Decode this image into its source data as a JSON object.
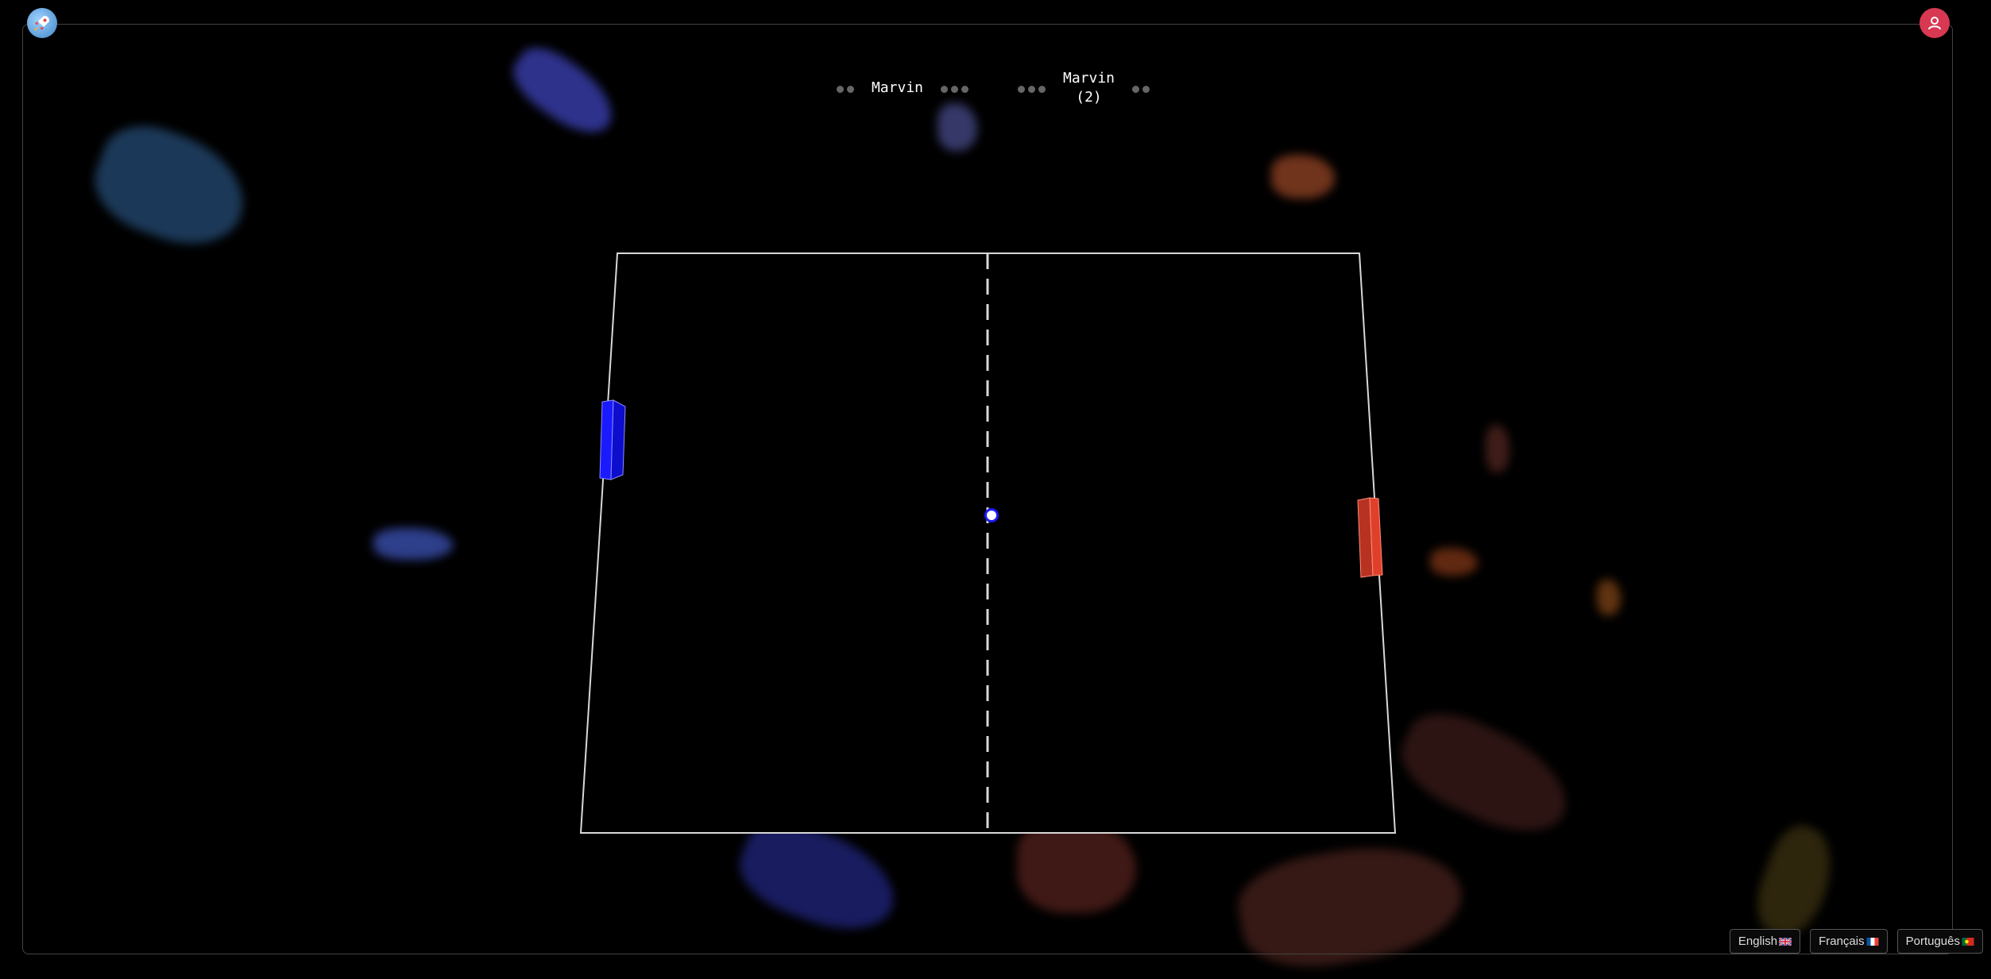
{
  "app": {
    "logo_icon": "rocket-icon",
    "profile_icon": "user-icon",
    "accent_user": "#d83852"
  },
  "scoreboard": {
    "player_left": {
      "name": "Marvin",
      "dots_before": 2,
      "dots_after": 3
    },
    "player_right": {
      "name": "Marvin",
      "tag": "(2)",
      "dots_before": 3,
      "dots_after": 2
    }
  },
  "game": {
    "left_paddle_color": "#1a1aff",
    "right_paddle_color": "#e0402a",
    "ball_color": "#ffffff",
    "net_style": "dashed"
  },
  "languages": [
    {
      "label": "English",
      "flag": "gb-flag-icon"
    },
    {
      "label": "Français",
      "flag": "fr-flag-icon"
    },
    {
      "label": "Português",
      "flag": "pt-flag-icon"
    }
  ]
}
